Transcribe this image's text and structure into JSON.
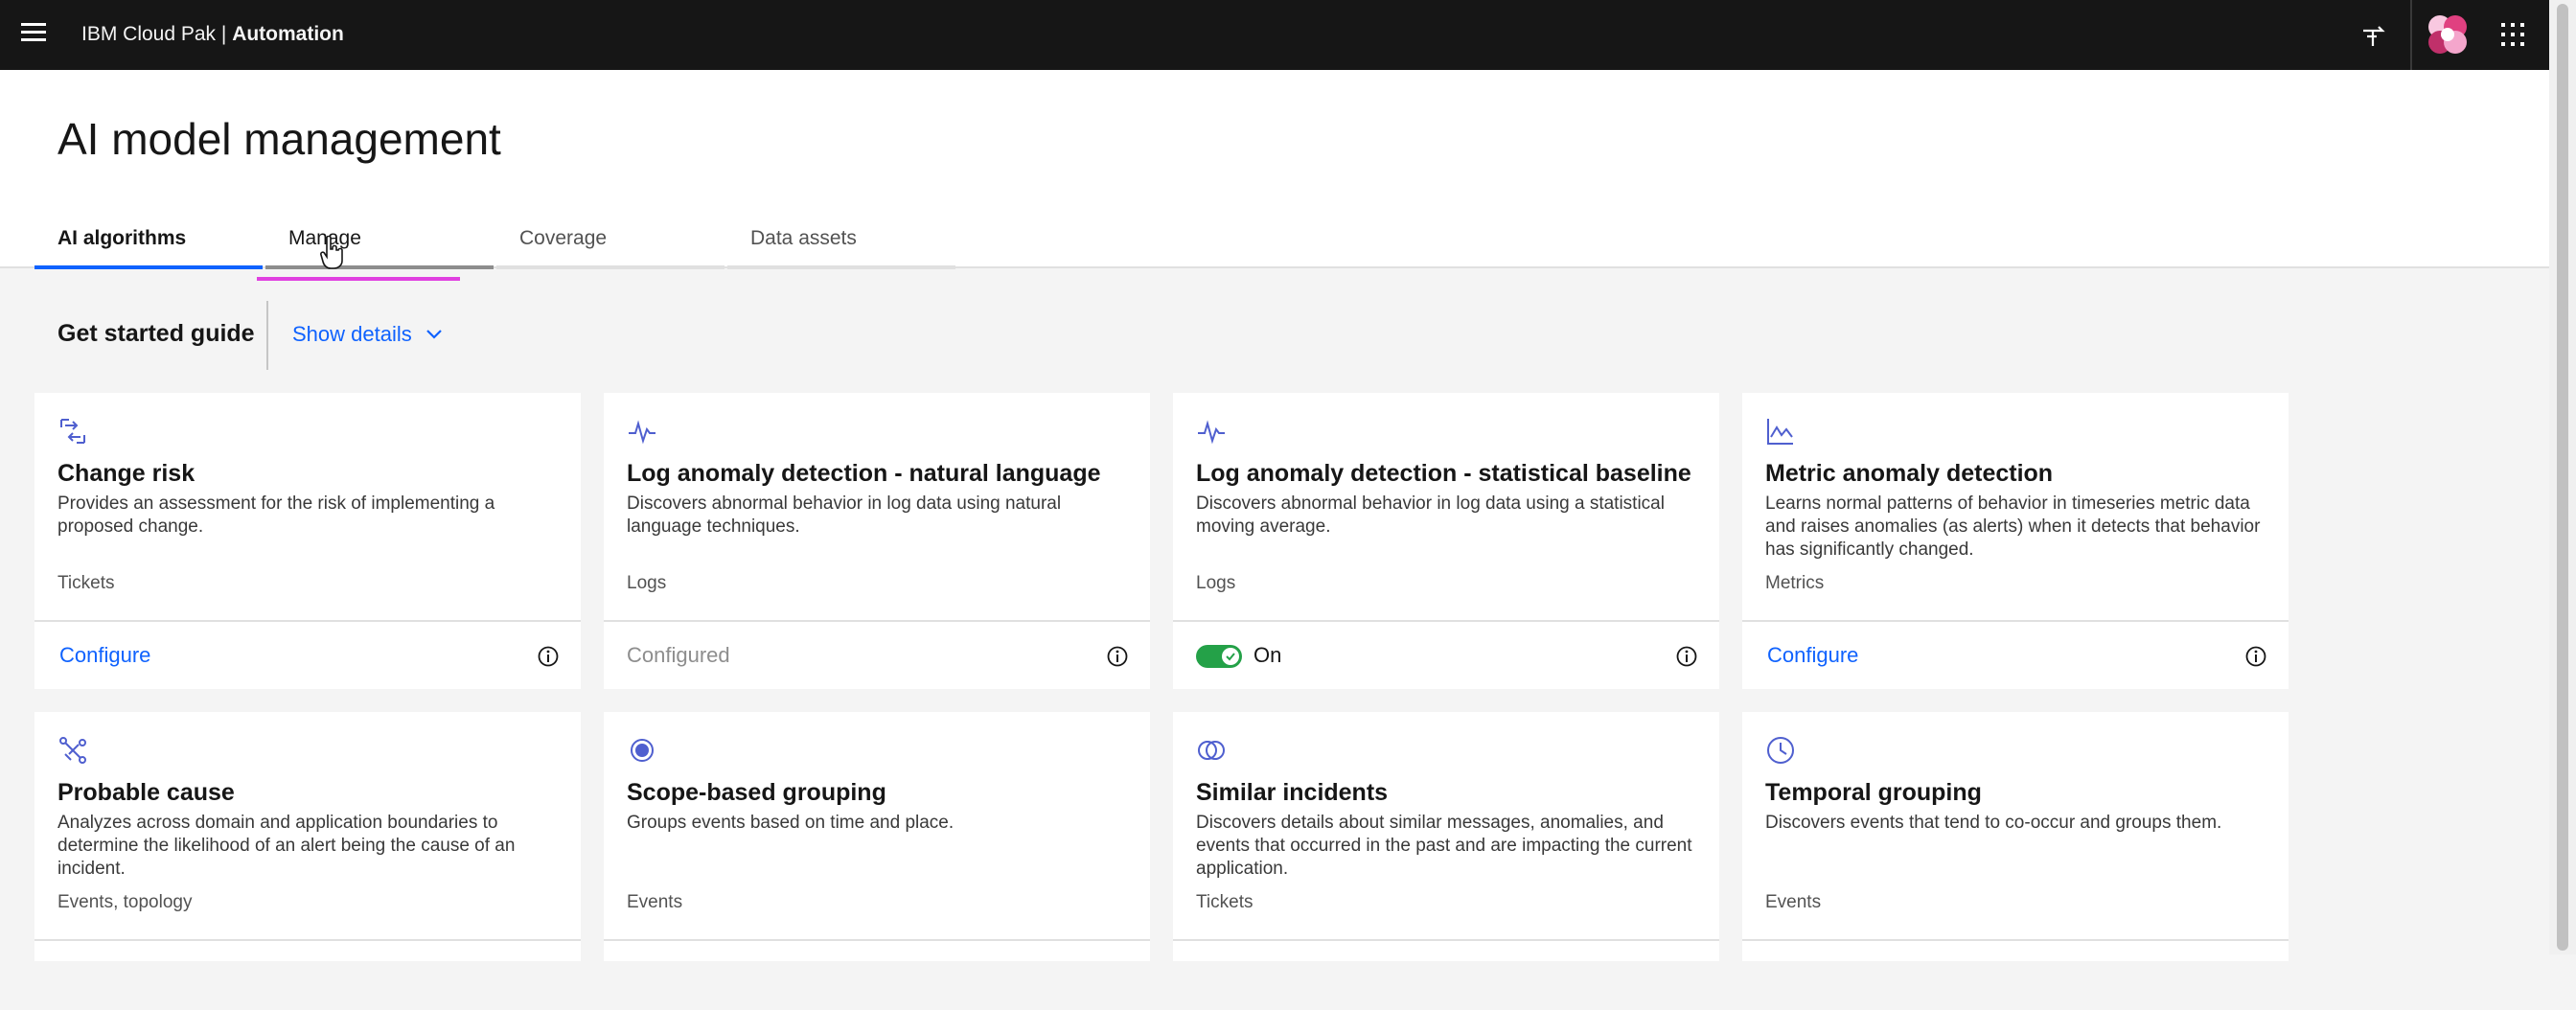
{
  "header": {
    "brand_prefix": "IBM Cloud Pak | ",
    "brand_product": "Automation"
  },
  "page": {
    "title": "AI model management",
    "tabs": [
      {
        "label": "AI algorithms"
      },
      {
        "label": "Manage"
      },
      {
        "label": "Coverage"
      },
      {
        "label": "Data assets"
      }
    ]
  },
  "guide": {
    "title": "Get started guide",
    "toggle_label": "Show details"
  },
  "cards": [
    {
      "title": "Change risk",
      "description": "Provides an assessment for the risk of implementing a proposed change.",
      "tag": "Tickets",
      "action": "Configure"
    },
    {
      "title": "Log anomaly detection - natural language",
      "description": "Discovers abnormal behavior in log data using natural language techniques.",
      "tag": "Logs",
      "status": "Configured"
    },
    {
      "title": "Log anomaly detection - statistical baseline",
      "description": "Discovers abnormal behavior in log data using a statistical moving average.",
      "tag": "Logs",
      "toggle_label": "On"
    },
    {
      "title": "Metric anomaly detection",
      "description": "Learns normal patterns of behavior in timeseries metric data and raises anomalies (as alerts) when it detects that behavior has significantly changed.",
      "tag": "Metrics",
      "action": "Configure"
    },
    {
      "title": "Probable cause",
      "description": "Analyzes across domain and application boundaries to determine the likelihood of an alert being the cause of an incident.",
      "tag": "Events, topology"
    },
    {
      "title": "Scope-based grouping",
      "description": "Groups events based on time and place.",
      "tag": "Events"
    },
    {
      "title": "Similar incidents",
      "description": "Discovers details about similar messages, anomalies, and events that occurred in the past and are impacting the current application.",
      "tag": "Tickets"
    },
    {
      "title": "Temporal grouping",
      "description": "Discovers events that tend to co-occur and groups them.",
      "tag": "Events"
    }
  ],
  "colors": {
    "accent": "#0f62fe",
    "header_bg": "#161616",
    "toggle_on": "#24a148",
    "icon": "#4f5fcf",
    "focus": "#e040e0"
  },
  "icons": [
    "menu-icon",
    "pin-icon",
    "user-avatar",
    "app-switcher-icon",
    "chevron-down-icon",
    "information-icon",
    "change-risk-icon",
    "activity-icon",
    "chart-icon",
    "probable-cause-icon",
    "scope-icon",
    "similar-icon",
    "clock-icon",
    "pointer-cursor-icon"
  ]
}
